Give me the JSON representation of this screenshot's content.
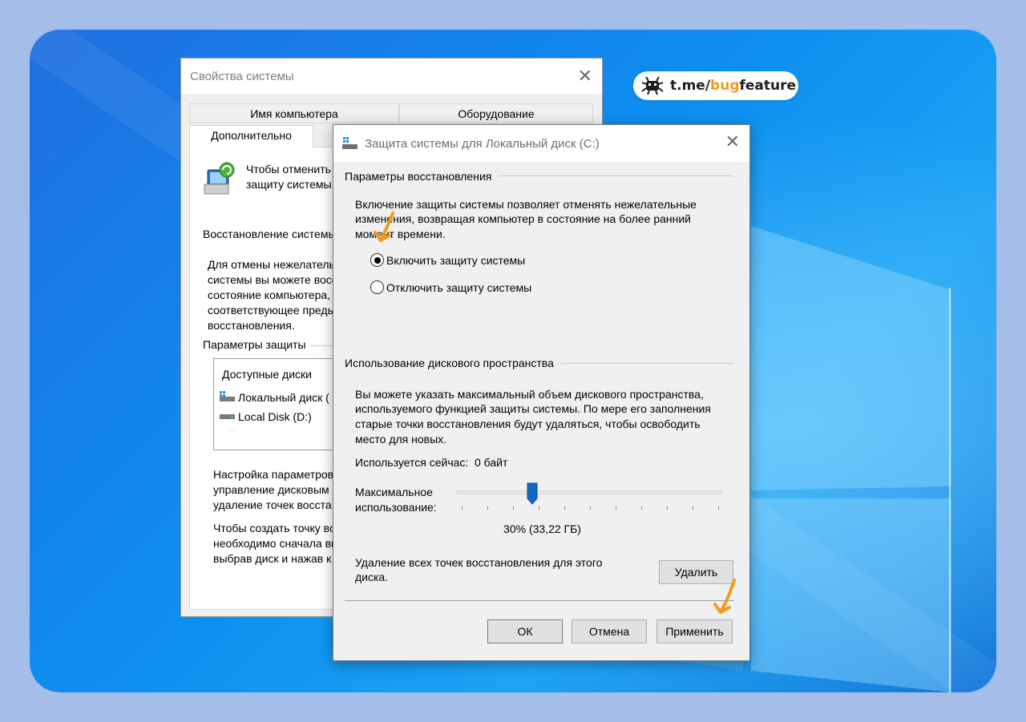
{
  "badge": {
    "text_prefix": "t.me/",
    "text_accent": "bug",
    "text_suffix": "feature"
  },
  "system_properties": {
    "title": "Свойства системы",
    "tabs": [
      "Имя компьютера",
      "Оборудование",
      "Дополнительно"
    ],
    "header_text": [
      "Чтобы отменить",
      "защиту системы"
    ],
    "restore_heading": "Восстановление системы",
    "restore_desc": [
      "Для отмены нежелатель",
      "системы вы можете восс",
      "состояние компьютера,",
      "соответствующее преды",
      "восстановления."
    ],
    "protection_heading": "Параметры защиты",
    "disks_header": "Доступные диски",
    "disks": [
      "Локальный диск (",
      "Local Disk (D:)"
    ],
    "config_desc": [
      "Настройка параметров",
      "управление дисковым",
      "удаление точек восста"
    ],
    "create_desc": [
      "Чтобы создать точку во",
      "необходимо сначала вк",
      "выбрав диск и нажав к"
    ]
  },
  "dialog": {
    "title": "Защита системы для Локальный диск (C:)",
    "restore_group": "Параметры восстановления",
    "restore_desc": [
      "Включение защиты системы позволяет отменять нежелательные",
      "изменения, возвращая компьютер в состояние на более ранний",
      "момент времени."
    ],
    "radio_on": "Включить защиту системы",
    "radio_off": "Отключить защиту системы",
    "disk_group": "Использование дискового пространства",
    "disk_desc": [
      "Вы можете указать максимальный объем дискового пространства,",
      "используемого функцией защиты системы. По мере его заполнения",
      "старые точки восстановления будут удаляться, чтобы освободить",
      "место для новых."
    ],
    "current_usage_label": "Используется сейчас:",
    "current_usage_value": "0 байт",
    "max_usage_label": [
      "Максимальное",
      "использование:"
    ],
    "slider_percent": 30,
    "slider_value_text": "30% (33,22 ГБ)",
    "delete_desc": [
      "Удаление всех точек восстановления для этого",
      "диска."
    ],
    "delete_button": "Удалить",
    "ok_button": "ОК",
    "cancel_button": "Отмена",
    "apply_button": "Применить"
  },
  "colors": {
    "accent_orange": "#f39a1c",
    "desktop_blue": "#0d8ef0"
  }
}
